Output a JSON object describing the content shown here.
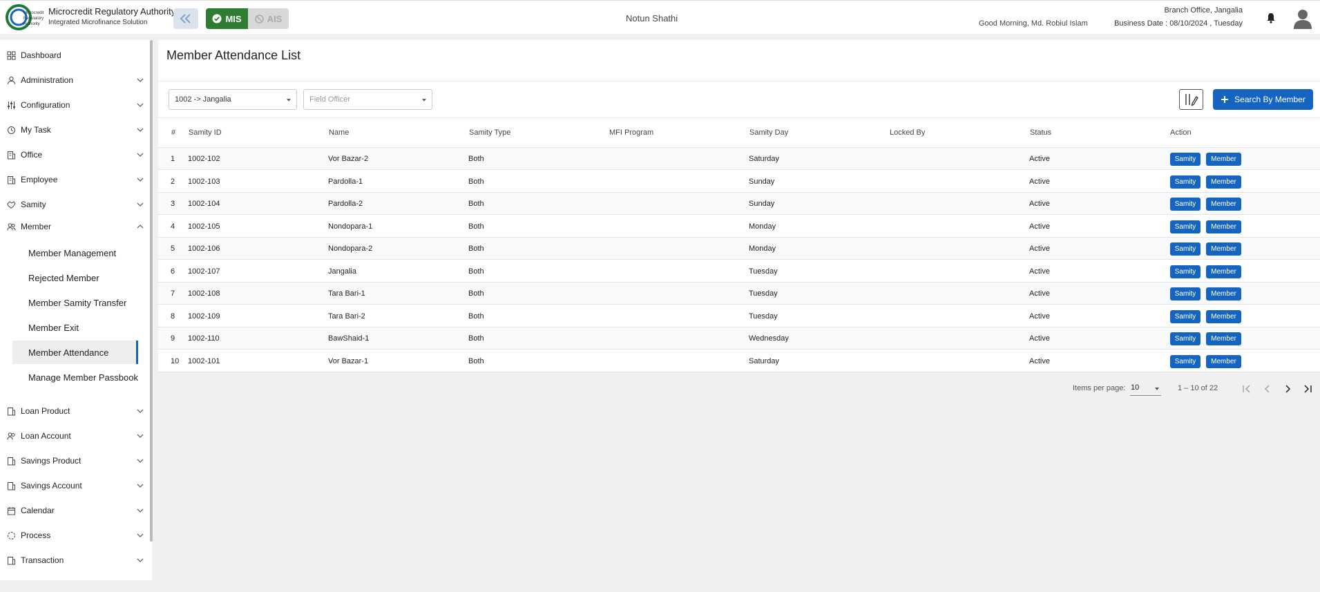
{
  "header": {
    "org_title": "Microcredit Regulatory Authority",
    "org_subtitle": "Integrated Microfinance Solution",
    "logo_text": "Microcredit Regulatory Authority",
    "toggle_on": "MIS",
    "toggle_off": "AIS",
    "app_name": "Notun Shathi",
    "greeting": "Good Morning, Md. Robiul Islam",
    "branch": "Branch Office, Jangalia",
    "business_date": "Business Date : 08/10/2024 , Tuesday"
  },
  "colors": {
    "primary": "#1565c0",
    "mis_green": "#2e7d32",
    "active_bar": "#1565c0"
  },
  "sidebar": {
    "items": [
      {
        "label": "Dashboard",
        "icon": "grid-icon"
      },
      {
        "label": "Administration",
        "icon": "admin-icon"
      },
      {
        "label": "Configuration",
        "icon": "sliders-icon"
      },
      {
        "label": "My Task",
        "icon": "task-icon"
      },
      {
        "label": "Office",
        "icon": "office-icon"
      },
      {
        "label": "Employee",
        "icon": "employee-icon"
      },
      {
        "label": "Samity",
        "icon": "handshake-icon"
      },
      {
        "label": "Member",
        "icon": "member-icon"
      }
    ],
    "member_sub": [
      {
        "label": "Member Management"
      },
      {
        "label": "Rejected Member"
      },
      {
        "label": "Member Samity Transfer"
      },
      {
        "label": "Member Exit"
      },
      {
        "label": "Member Attendance"
      },
      {
        "label": "Manage Member Passbook"
      }
    ],
    "items_after": [
      {
        "label": "Loan Product"
      },
      {
        "label": "Loan Account"
      },
      {
        "label": "Savings Product"
      },
      {
        "label": "Savings Account"
      },
      {
        "label": "Calendar"
      },
      {
        "label": "Process"
      },
      {
        "label": "Transaction"
      }
    ]
  },
  "page": {
    "title": "Member Attendance List",
    "branch_select": "1002 -> Jangalia",
    "officer_placeholder": "Field Officer",
    "search_button": "Search By Member"
  },
  "table": {
    "headers": [
      "#",
      "Samity ID",
      "Name",
      "Samity Type",
      "MFI Program",
      "Samity Day",
      "Locked By",
      "Status",
      "Action"
    ],
    "action_labels": {
      "samity": "Samity",
      "member": "Member"
    },
    "rows": [
      {
        "n": "1",
        "id": "1002-102",
        "name": "Vor Bazar-2",
        "type": "Both",
        "mfi": "",
        "day": "Saturday",
        "locked": "",
        "status": "Active"
      },
      {
        "n": "2",
        "id": "1002-103",
        "name": "Pardolla-1",
        "type": "Both",
        "mfi": "",
        "day": "Sunday",
        "locked": "",
        "status": "Active"
      },
      {
        "n": "3",
        "id": "1002-104",
        "name": "Pardolla-2",
        "type": "Both",
        "mfi": "",
        "day": "Sunday",
        "locked": "",
        "status": "Active"
      },
      {
        "n": "4",
        "id": "1002-105",
        "name": "Nondopara-1",
        "type": "Both",
        "mfi": "",
        "day": "Monday",
        "locked": "",
        "status": "Active"
      },
      {
        "n": "5",
        "id": "1002-106",
        "name": "Nondopara-2",
        "type": "Both",
        "mfi": "",
        "day": "Monday",
        "locked": "",
        "status": "Active"
      },
      {
        "n": "6",
        "id": "1002-107",
        "name": "Jangalia",
        "type": "Both",
        "mfi": "",
        "day": "Tuesday",
        "locked": "",
        "status": "Active"
      },
      {
        "n": "7",
        "id": "1002-108",
        "name": "Tara Bari-1",
        "type": "Both",
        "mfi": "",
        "day": "Tuesday",
        "locked": "",
        "status": "Active"
      },
      {
        "n": "8",
        "id": "1002-109",
        "name": "Tara Bari-2",
        "type": "Both",
        "mfi": "",
        "day": "Tuesday",
        "locked": "",
        "status": "Active"
      },
      {
        "n": "9",
        "id": "1002-110",
        "name": "BawShaid-1",
        "type": "Both",
        "mfi": "",
        "day": "Wednesday",
        "locked": "",
        "status": "Active"
      },
      {
        "n": "10",
        "id": "1002-101",
        "name": "Vor Bazar-1",
        "type": "Both",
        "mfi": "",
        "day": "Saturday",
        "locked": "",
        "status": "Active"
      }
    ]
  },
  "paginator": {
    "items_per_page_label": "Items per page:",
    "page_size": "10",
    "range": "1 – 10 of 22"
  }
}
